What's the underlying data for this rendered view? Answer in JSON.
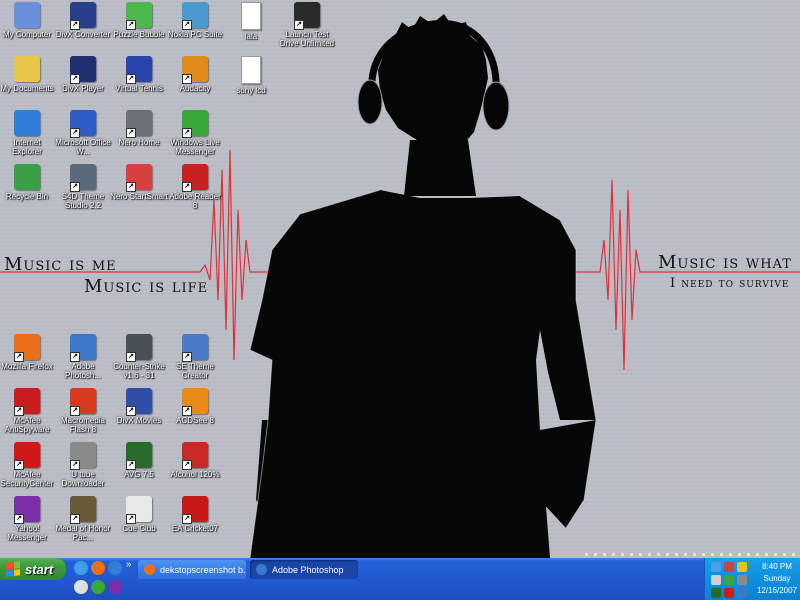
{
  "desktop": {
    "icons_top": [
      {
        "label": "My Computer",
        "icon": "my-computer-icon",
        "color": "#6b8fd8",
        "col": 0,
        "row": 0,
        "shortcut": false
      },
      {
        "label": "My Documents",
        "icon": "my-documents-icon",
        "color": "#e8c64a",
        "col": 0,
        "row": 1,
        "shortcut": false
      },
      {
        "label": "Internet Explorer",
        "icon": "internet-explorer-icon",
        "color": "#2f7fd8",
        "col": 0,
        "row": 2,
        "shortcut": false
      },
      {
        "label": "Recycle Bin",
        "icon": "recycle-bin-icon",
        "color": "#3aa047",
        "col": 0,
        "row": 3,
        "shortcut": false
      },
      {
        "label": "DivX Converter",
        "icon": "divx-converter-icon",
        "color": "#2a3f8a",
        "col": 1,
        "row": 0,
        "shortcut": true
      },
      {
        "label": "DivX Player",
        "icon": "divx-player-icon",
        "color": "#1f2f70",
        "col": 1,
        "row": 1,
        "shortcut": true
      },
      {
        "label": "Microsoft Office W...",
        "icon": "word-icon",
        "color": "#2e5bc4",
        "col": 1,
        "row": 2,
        "shortcut": true
      },
      {
        "label": "S4D Theme Studio 2.2",
        "icon": "theme-studio-icon",
        "color": "#5b6a7a",
        "col": 1,
        "row": 3,
        "shortcut": true
      },
      {
        "label": "Puzzle Bubble",
        "icon": "puzzle-bubble-icon",
        "color": "#4cb84c",
        "col": 2,
        "row": 0,
        "shortcut": true
      },
      {
        "label": "Virtual Tennis",
        "icon": "virtual-tennis-icon",
        "color": "#2844a8",
        "col": 2,
        "row": 1,
        "shortcut": true
      },
      {
        "label": "Nero Home",
        "icon": "nero-home-icon",
        "color": "#6a6f78",
        "col": 2,
        "row": 2,
        "shortcut": true
      },
      {
        "label": "Nero StartSmart",
        "icon": "nero-startsmart-icon",
        "color": "#d64040",
        "col": 2,
        "row": 3,
        "shortcut": true
      },
      {
        "label": "Nokia PC Suite",
        "icon": "nokia-pc-suite-icon",
        "color": "#4a9ad0",
        "col": 3,
        "row": 0,
        "shortcut": true
      },
      {
        "label": "Audacity",
        "icon": "audacity-icon",
        "color": "#e08a1a",
        "col": 3,
        "row": 1,
        "shortcut": true
      },
      {
        "label": "Windows Live Messenger",
        "icon": "messenger-icon",
        "color": "#38a838",
        "col": 3,
        "row": 2,
        "shortcut": true
      },
      {
        "label": "Adobe Reader 8",
        "icon": "adobe-reader-icon",
        "color": "#c82020",
        "col": 3,
        "row": 3,
        "shortcut": true
      },
      {
        "label": "lala",
        "icon": "text-file-icon",
        "color": "#ffffff",
        "col": 4,
        "row": 0,
        "shortcut": false,
        "doc": true
      },
      {
        "label": "sony lcd",
        "icon": "text-file-icon",
        "color": "#ffffff",
        "col": 4,
        "row": 1,
        "shortcut": false,
        "doc": true
      },
      {
        "label": "Launch Test Drive Unlimited",
        "icon": "test-drive-icon",
        "color": "#2a2a2a",
        "col": 5,
        "row": 0,
        "shortcut": true
      }
    ],
    "icons_bottom": [
      {
        "label": "Mozilla Firefox",
        "icon": "firefox-icon",
        "color": "#e8701a",
        "col": 0,
        "row": 0,
        "shortcut": true
      },
      {
        "label": "McAfee AntiSpyware",
        "icon": "mcafee-antispyware-icon",
        "color": "#c81e1e",
        "col": 0,
        "row": 1,
        "shortcut": true
      },
      {
        "label": "McAfee SecurityCenter",
        "icon": "mcafee-securitycenter-icon",
        "color": "#d01818",
        "col": 0,
        "row": 2,
        "shortcut": true
      },
      {
        "label": "Yahoo! Messenger",
        "icon": "yahoo-messenger-icon",
        "color": "#7b2fa8",
        "col": 0,
        "row": 3,
        "shortcut": true
      },
      {
        "label": "Adobe Photosh...",
        "icon": "photoshop-icon",
        "color": "#3a78c8",
        "col": 1,
        "row": 0,
        "shortcut": true
      },
      {
        "label": "Macromedia Flash 8",
        "icon": "flash-icon",
        "color": "#d83a1e",
        "col": 1,
        "row": 1,
        "shortcut": true
      },
      {
        "label": "U tube Downloader",
        "icon": "utube-downloader-icon",
        "color": "#8a8a8a",
        "col": 1,
        "row": 2,
        "shortcut": true
      },
      {
        "label": "Medal of Honor Pac...",
        "icon": "medal-of-honor-icon",
        "color": "#6a5a3a",
        "col": 1,
        "row": 3,
        "shortcut": true
      },
      {
        "label": "Counter-Strike v1.6 - 31",
        "icon": "counter-strike-icon",
        "color": "#4a5058",
        "col": 2,
        "row": 0,
        "shortcut": true
      },
      {
        "label": "DivX Movies",
        "icon": "divx-movies-icon",
        "color": "#2f4ea8",
        "col": 2,
        "row": 1,
        "shortcut": true
      },
      {
        "label": "AVG 7.5",
        "icon": "avg-icon",
        "color": "#2a6a2a",
        "col": 2,
        "row": 2,
        "shortcut": true
      },
      {
        "label": "Cue Club",
        "icon": "cue-club-icon",
        "color": "#e8e8e8",
        "col": 2,
        "row": 3,
        "shortcut": true
      },
      {
        "label": "SE Theme Creator",
        "icon": "theme-creator-icon",
        "color": "#4a7ac8",
        "col": 3,
        "row": 0,
        "shortcut": true
      },
      {
        "label": "ACDSee 8",
        "icon": "acdsee-icon",
        "color": "#e88a1a",
        "col": 3,
        "row": 1,
        "shortcut": true
      },
      {
        "label": "Alcohol 120%",
        "icon": "alcohol-icon",
        "color": "#c82a2a",
        "col": 3,
        "row": 2,
        "shortcut": true
      },
      {
        "label": "EA Cricket07",
        "icon": "ea-cricket-icon",
        "color": "#c81818",
        "col": 3,
        "row": 3,
        "shortcut": true
      }
    ]
  },
  "wallpaper": {
    "line1": "Music is me",
    "line2": "Music is life",
    "line3": "Music is what",
    "line4": "I need to survive",
    "pulse_color": "#e0303a"
  },
  "taskbar": {
    "start_label": "start",
    "quick_launch": [
      {
        "icon": "show-desktop-icon",
        "color": "#3aa0e8"
      },
      {
        "icon": "firefox-icon",
        "color": "#e8701a"
      },
      {
        "icon": "internet-explorer-icon",
        "color": "#2f7fd8"
      },
      {
        "icon": "media-player-icon",
        "color": "#e0e0e0"
      },
      {
        "icon": "messenger-icon",
        "color": "#38a838"
      },
      {
        "icon": "yahoo-messenger-icon",
        "color": "#7b2fa8"
      }
    ],
    "overflow_label": "»",
    "tasks": [
      {
        "label": "dekstopscreenshot b...",
        "icon": "firefox-icon",
        "color": "#e8701a",
        "active": false
      },
      {
        "label": "Adobe Photoshop",
        "icon": "photoshop-icon",
        "color": "#3a78c8",
        "active": true
      }
    ],
    "tray": {
      "time": "8:40 PM",
      "day": "Sunday",
      "date": "12/16/2007",
      "icons": [
        {
          "icon": "network-icon",
          "color": "#4aa0e8"
        },
        {
          "icon": "nero-tray-icon",
          "color": "#d04040"
        },
        {
          "icon": "yahoo-tray-icon",
          "color": "#e8c020"
        },
        {
          "icon": "volume-icon",
          "color": "#d0d0d0"
        },
        {
          "icon": "messenger-tray-icon",
          "color": "#38a838"
        },
        {
          "icon": "safely-remove-icon",
          "color": "#8a8a8a"
        },
        {
          "icon": "avg-tray-icon",
          "color": "#2a6a2a"
        },
        {
          "icon": "mcafee-tray-icon",
          "color": "#c81e1e"
        },
        {
          "icon": "security-tray-icon",
          "color": "#3a78c8"
        }
      ]
    }
  }
}
